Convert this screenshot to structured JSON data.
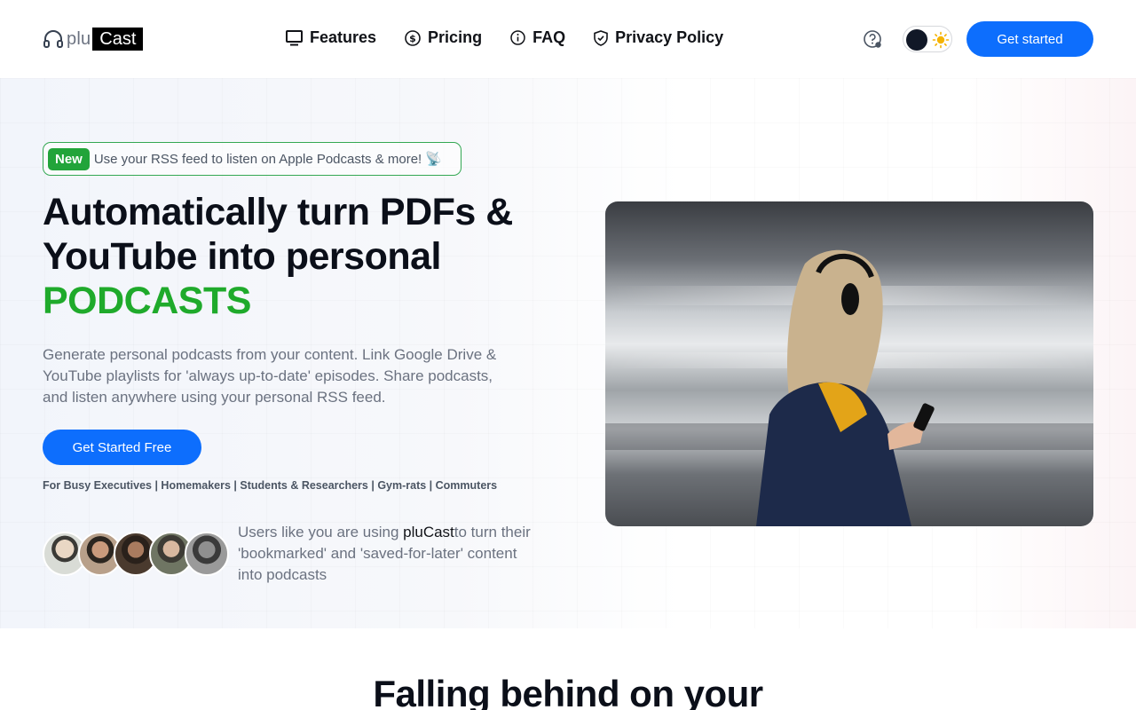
{
  "brand": {
    "part1": "plu",
    "part2": "Cast"
  },
  "nav": {
    "items": [
      {
        "label": "Features",
        "icon": "monitor-icon"
      },
      {
        "label": "Pricing",
        "icon": "dollar-circle-icon"
      },
      {
        "label": "FAQ",
        "icon": "info-circle-icon"
      },
      {
        "label": "Privacy Policy",
        "icon": "shield-check-icon"
      }
    ]
  },
  "header": {
    "cta_label": "Get started",
    "help_icon": "help-circle-icon",
    "theme_toggle_icon": "sun-icon"
  },
  "hero": {
    "badge_tag": "New",
    "badge_text": "Use your RSS feed to listen on Apple Podcasts & more! 📡",
    "headline_line1": "Automatically turn PDFs &",
    "headline_line2": "YouTube into personal",
    "headline_highlight": "PODCASTS",
    "lead": "Generate personal podcasts from your content. Link Google Drive & YouTube playlists for 'always up-to-date' episodes. Share podcasts, and listen anywhere using your personal RSS feed.",
    "cta_label": "Get Started Free",
    "audience": "For Busy Executives | Homemakers | Students & Researchers | Gym-rats | Commuters",
    "social_proof_pre": "Users like you are using ",
    "social_proof_brand": "pluCast",
    "social_proof_post": "to turn their 'bookmarked' and 'saved-for-later' content into podcasts"
  },
  "section2": {
    "heading": "Falling behind on your"
  },
  "colors": {
    "accent": "#0d6efd",
    "highlight": "#1faa2b",
    "badge_green": "#22a43a",
    "text": "#111318",
    "muted": "#6b7280"
  }
}
